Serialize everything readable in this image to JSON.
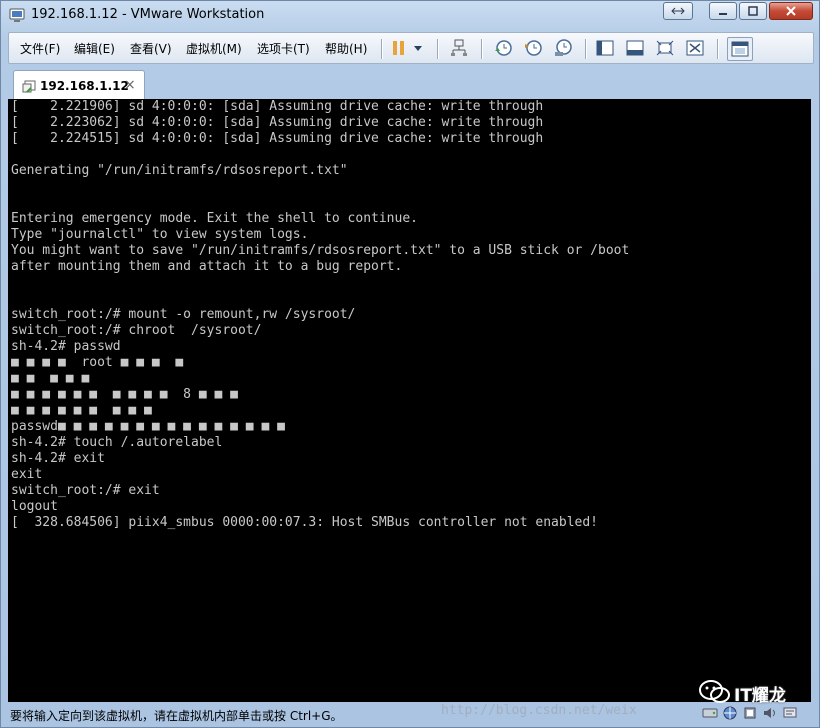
{
  "window": {
    "title": "192.168.1.12 - VMware Workstation"
  },
  "menu": {
    "items": [
      {
        "label": "文件(F)"
      },
      {
        "label": "编辑(E)"
      },
      {
        "label": "查看(V)"
      },
      {
        "label": "虚拟机(M)"
      },
      {
        "label": "选项卡(T)"
      },
      {
        "label": "帮助(H)"
      }
    ]
  },
  "tabs": [
    {
      "label": "192.168.1.12",
      "close": "×"
    }
  ],
  "console": {
    "lines": [
      "[    2.221906] sd 4:0:0:0: [sda] Assuming drive cache: write through",
      "[    2.223062] sd 4:0:0:0: [sda] Assuming drive cache: write through",
      "[    2.224515] sd 4:0:0:0: [sda] Assuming drive cache: write through",
      "",
      "Generating \"/run/initramfs/rdsosreport.txt\"",
      "",
      "",
      "Entering emergency mode. Exit the shell to continue.",
      "Type \"journalctl\" to view system logs.",
      "You might want to save \"/run/initramfs/rdsosreport.txt\" to a USB stick or /boot",
      "after mounting them and attach it to a bug report.",
      "",
      "",
      "switch_root:/# mount -o remount,rw /sysroot/",
      "switch_root:/# chroot  /sysroot/",
      "sh-4.2# passwd",
      "■ ■ ■ ■  root ■ ■ ■  ■",
      "■ ■  ■ ■ ■",
      "■ ■ ■ ■ ■ ■  ■ ■ ■ ■  8 ■ ■ ■",
      "■ ■ ■ ■ ■ ■  ■ ■ ■",
      "passwd■ ■ ■ ■ ■ ■ ■ ■ ■ ■ ■ ■ ■ ■ ■",
      "sh-4.2# touch /.autorelabel",
      "sh-4.2# exit",
      "exit",
      "switch_root:/# exit",
      "logout",
      "[  328.684506] piix4_smbus 0000:00:07.3: Host SMBus controller not enabled!"
    ]
  },
  "status": {
    "text": "要将输入定向到该虚拟机，请在虚拟机内部单击或按 Ctrl+G。"
  },
  "watermark": {
    "url": "http://blog.csdn.net/weix",
    "brand": "IT耀龙"
  },
  "colors": {
    "console_bg": "#000000",
    "console_fg": "#c8c8c8",
    "accent": "#e8a33a"
  }
}
